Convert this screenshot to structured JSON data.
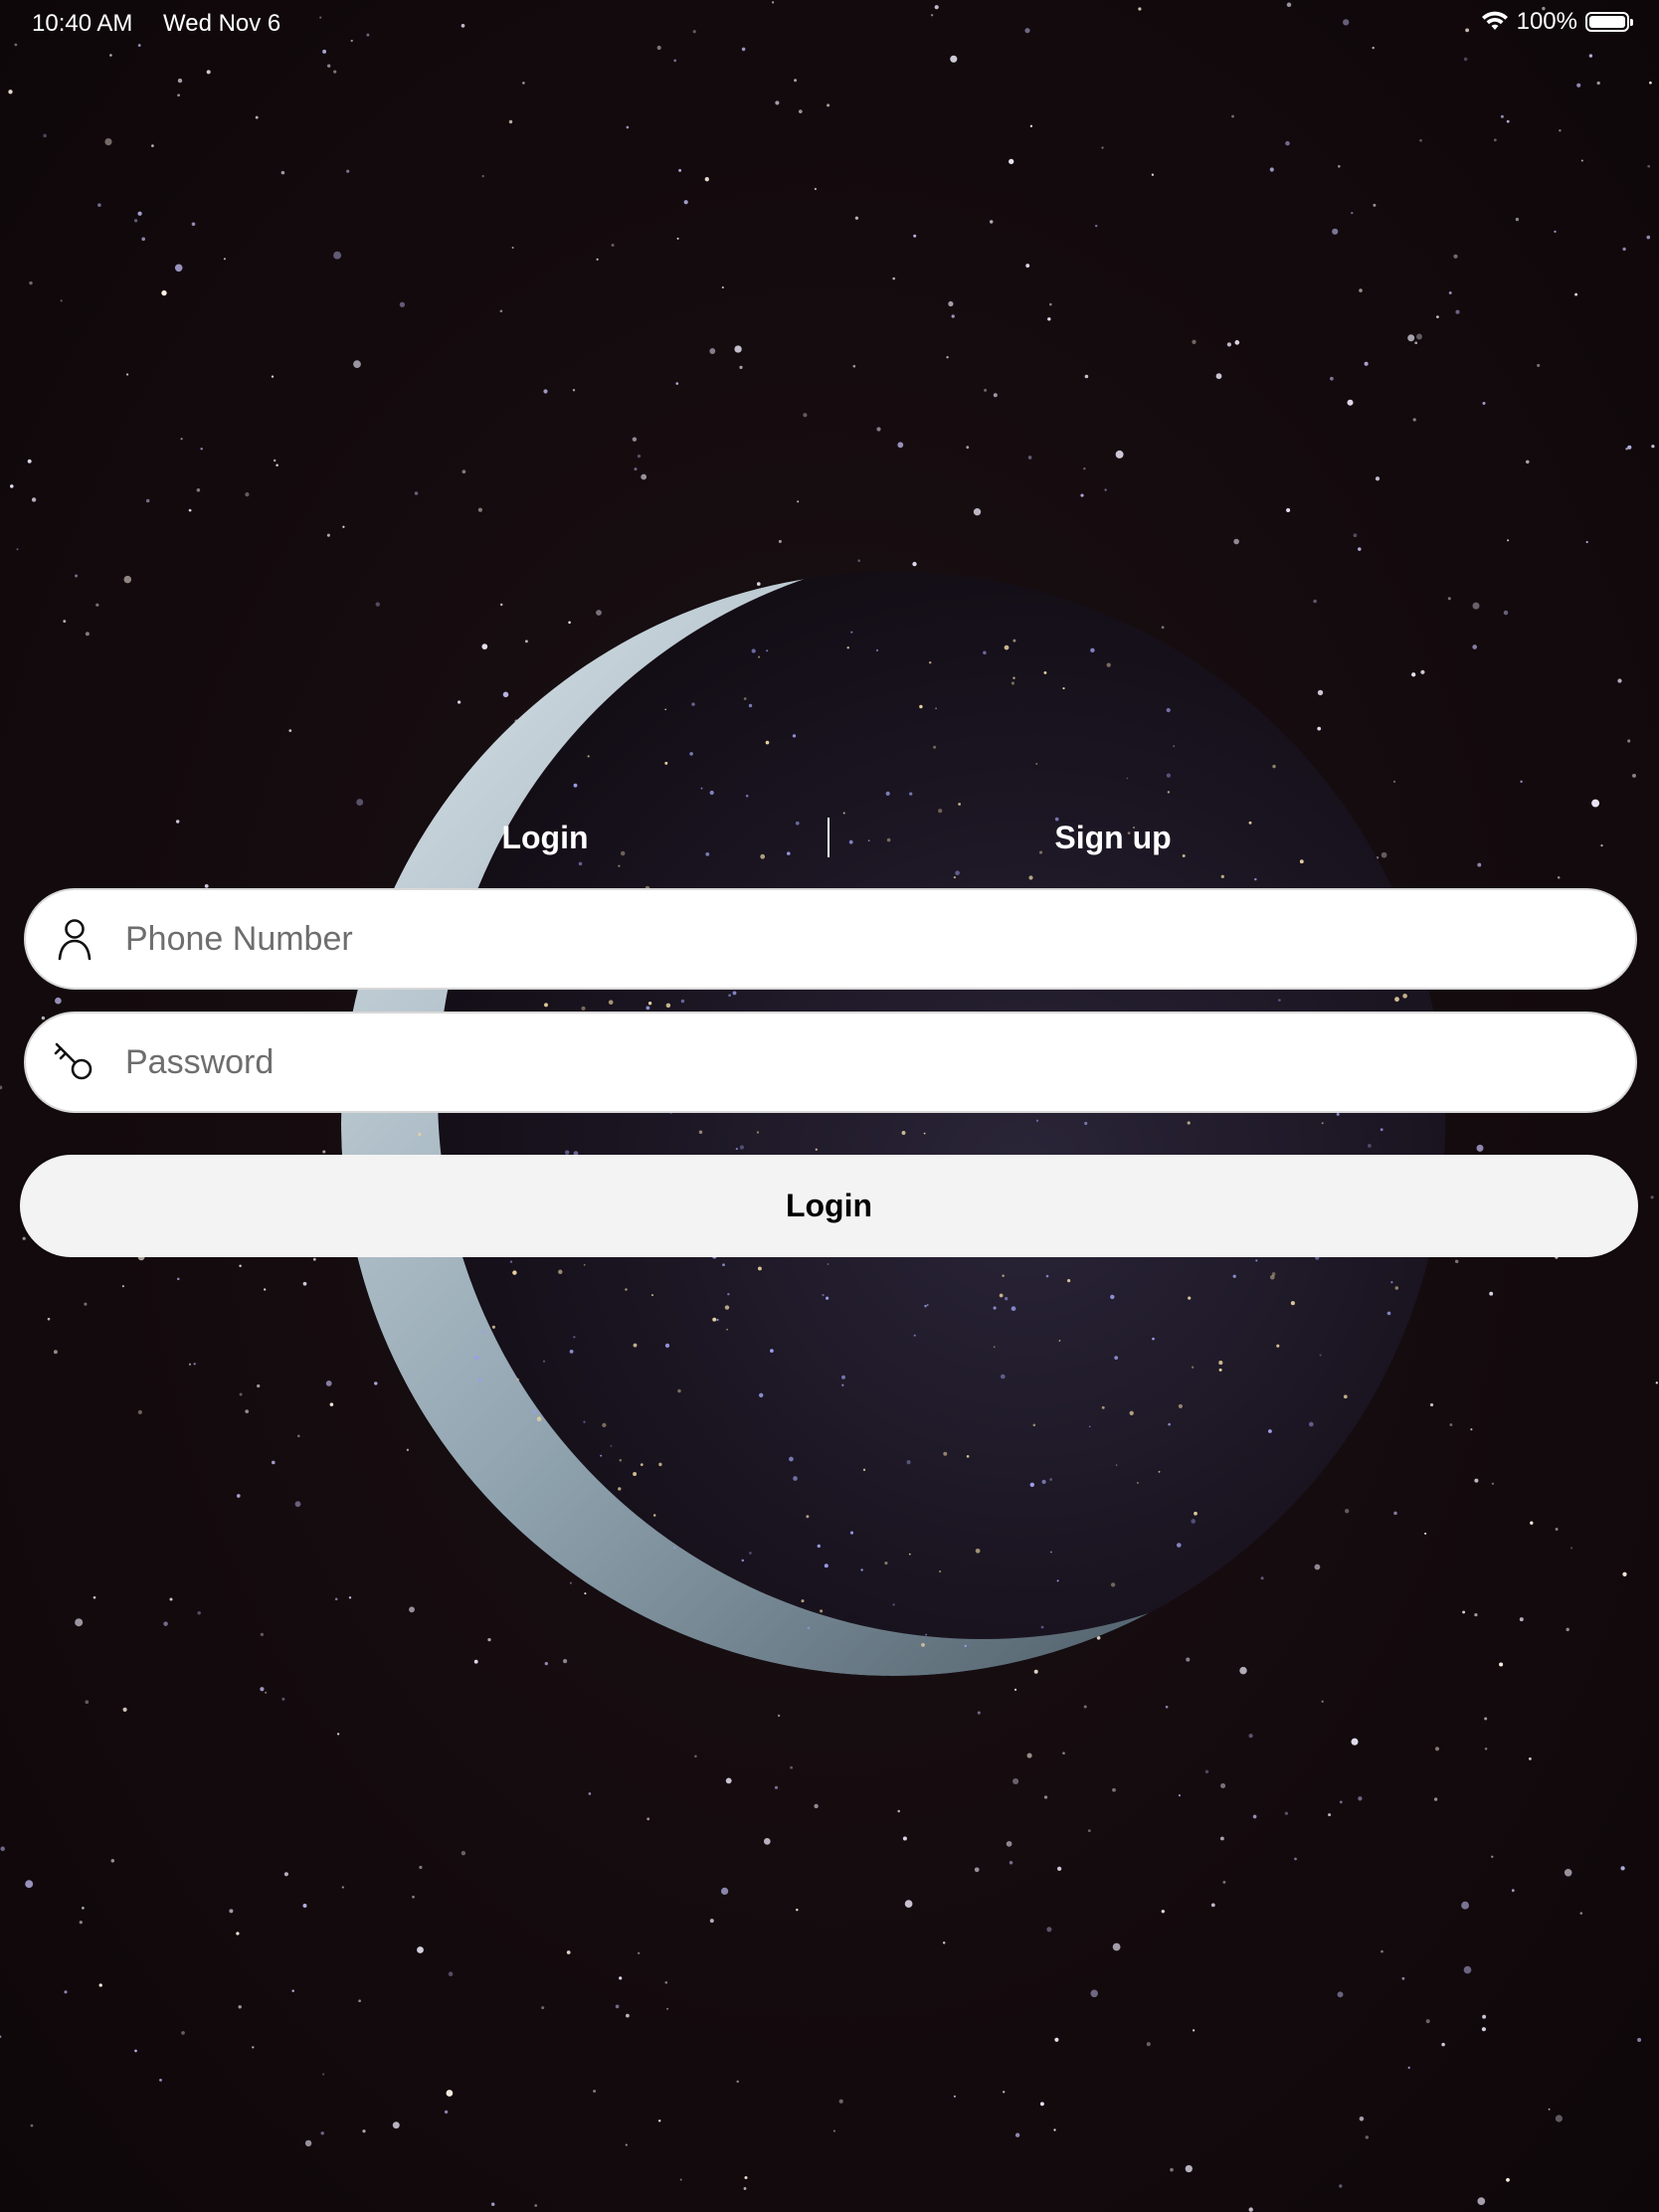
{
  "status_bar": {
    "time": "10:40 AM",
    "date": "Wed Nov 6",
    "battery_text": "100%",
    "battery_level": 1.0,
    "icons": [
      "wifi-icon",
      "battery-icon"
    ]
  },
  "auth_tabs": {
    "login_label": "Login",
    "signup_label": "Sign up",
    "selected": "Login"
  },
  "form": {
    "phone": {
      "placeholder": "Phone Number",
      "value": "",
      "icon": "person-icon"
    },
    "password": {
      "placeholder": "Password",
      "value": "",
      "icon": "key-icon"
    },
    "submit_label": "Login"
  },
  "colors": {
    "background": "#140b0e",
    "field_background": "#ffffff",
    "button_background": "#f3f3f3",
    "text_light": "#ffffff",
    "placeholder": "#6e6e6e"
  },
  "background_image": "night-sky-with-earth-crescent"
}
